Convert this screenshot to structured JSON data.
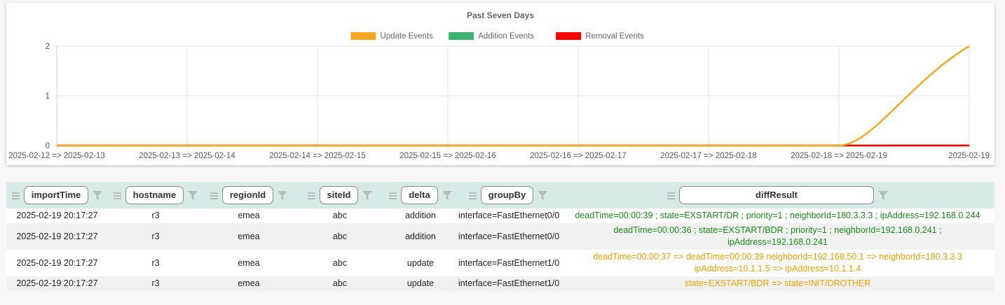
{
  "chart_data": {
    "type": "line",
    "title": "Past Seven Days",
    "categories": [
      "2025-02-12 => 2025-02-13",
      "2025-02-13 => 2025-02-14",
      "2025-02-14 => 2025-02-15",
      "2025-02-15 => 2025-02-16",
      "2025-02-16 => 2025-02-17",
      "2025-02-17 => 2025-02-18",
      "2025-02-18 => 2025-02-19",
      "2025-02-19"
    ],
    "series": [
      {
        "name": "Update Events",
        "color": "#f5a623",
        "values": [
          0,
          0,
          0,
          0,
          0,
          0,
          0,
          2
        ]
      },
      {
        "name": "Addition Events",
        "color": "#3cb371",
        "values": [
          0,
          0,
          0,
          0,
          0,
          0,
          0,
          0
        ]
      },
      {
        "name": "Removal Events",
        "color": "#ff0000",
        "values": [
          0,
          0,
          0,
          0,
          0,
          0,
          0,
          0
        ]
      }
    ],
    "yticks": [
      "0",
      "1",
      "2"
    ],
    "ylim": [
      0,
      2
    ],
    "grid": true,
    "legend": "top-center"
  },
  "table": {
    "columns": [
      "importTime",
      "hostname",
      "regionId",
      "siteId",
      "delta",
      "groupBy",
      "diffResult"
    ],
    "rows": [
      {
        "importTime": "2025-02-19 20:17:27",
        "hostname": "r3",
        "regionId": "emea",
        "siteId": "abc",
        "delta": "addition",
        "groupBy": "interface=FastEthernet0/0",
        "diffResult": "deadTime=00:00:39 ; state=EXSTART/DR ; priority=1 ; neighborId=180.3.3.3 ; ipAddress=192.168.0.244"
      },
      {
        "importTime": "2025-02-19 20:17:27",
        "hostname": "r3",
        "regionId": "emea",
        "siteId": "abc",
        "delta": "addition",
        "groupBy": "interface=FastEthernet0/0",
        "diffResult": "deadTime=00:00:36 ; state=EXSTART/BDR ; priority=1 ; neighborId=192.168.0.241 ; ipAddress=192.168.0.241"
      },
      {
        "importTime": "2025-02-19 20:17:27",
        "hostname": "r3",
        "regionId": "emea",
        "siteId": "abc",
        "delta": "update",
        "groupBy": "interface=FastEthernet1/0",
        "diffResult": "deadTime=00:00:37 => deadTime=00:00:39 neighborId=192.168.50.1 => neighborId=180.3.3.3 ipAddress=10.1.1.5 => ipAddress=10.1.1.4"
      },
      {
        "importTime": "2025-02-19 20:17:27",
        "hostname": "r3",
        "regionId": "emea",
        "siteId": "abc",
        "delta": "update",
        "groupBy": "interface=FastEthernet1/0",
        "diffResult": "state=EXSTART/BDR => state=INIT/DROTHER"
      }
    ]
  }
}
